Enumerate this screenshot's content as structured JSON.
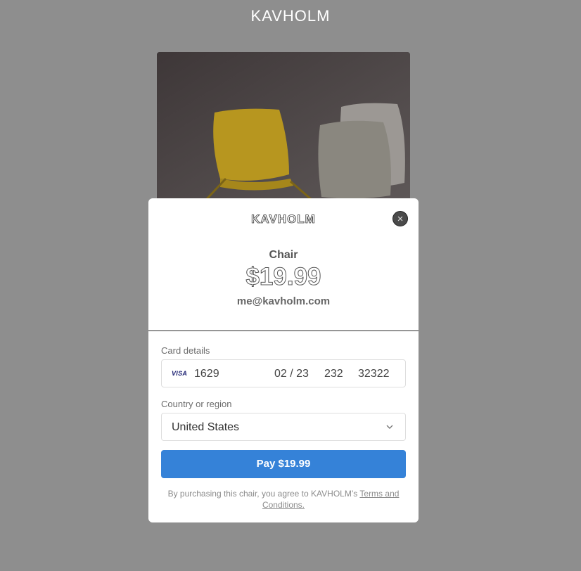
{
  "page": {
    "brand": "KAVHOLM"
  },
  "checkout": {
    "brand": "KAVHOLM",
    "close_icon": "close-icon",
    "product_name": "Chair",
    "price": "$19.99",
    "email": "me@kavholm.com",
    "card": {
      "label": "Card details",
      "brand_icon": "VISA",
      "number": "1629",
      "expiry": "02 / 23",
      "cvc": "232",
      "zip": "32322"
    },
    "country": {
      "label": "Country or region",
      "value": "United States",
      "chevron_icon": "chevron-down-icon"
    },
    "pay_button": "Pay $19.99",
    "terms_prefix": "By purchasing this chair, you agree to KAVHOLM’s ",
    "terms_link": "Terms and Conditions.",
    "accent_color": "#3582d8"
  }
}
